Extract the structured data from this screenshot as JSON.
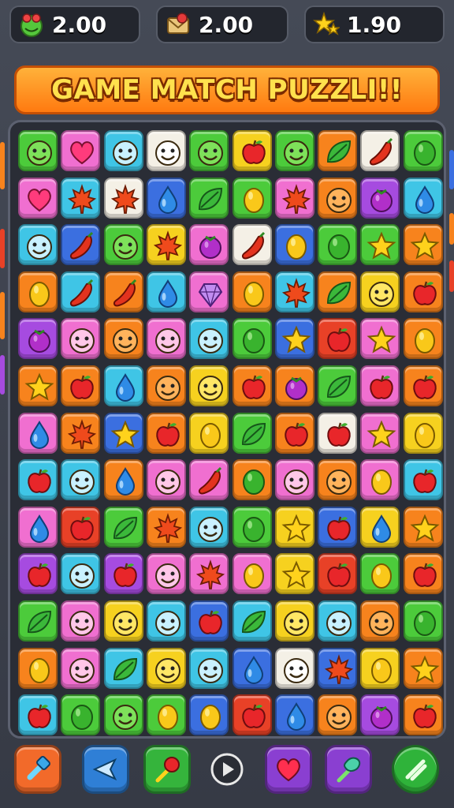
{
  "resources": [
    {
      "icon": "frog-face-icon",
      "value": "2.00"
    },
    {
      "icon": "envelope-icon",
      "value": "2.00"
    },
    {
      "icon": "star-cluster-icon",
      "value": "1.90"
    }
  ],
  "banner": {
    "title": "GAME MATCH PUZZLI!!"
  },
  "board": {
    "rows": 13,
    "cols": 10,
    "tiles": [
      [
        "green:face",
        "pink:heart",
        "cyan:face",
        "white:face",
        "green:face",
        "yellow:apple",
        "green:face",
        "orange:leaf",
        "white:pepper",
        "green:lime"
      ],
      [
        "pink:heart",
        "cyan:maple",
        "white:maple",
        "blue:drop",
        "green:leaf",
        "green:lemon",
        "pink:maple",
        "orange:face",
        "purple:berry",
        "cyan:drop"
      ],
      [
        "cyan:face",
        "blue:pepper",
        "green:face",
        "yellow:maple",
        "pink:berry",
        "white:pepper",
        "blue:lemon",
        "green:lime",
        "green:star",
        "orange:star"
      ],
      [
        "orange:lemon",
        "cyan:pepper",
        "orange:pepper",
        "cyan:drop",
        "pink:crystal",
        "orange:lemon",
        "cyan:maple",
        "orange:leaf",
        "yellow:face",
        "orange:apple"
      ],
      [
        "purple:berry",
        "pink:face",
        "orange:face",
        "pink:face",
        "cyan:face",
        "green:lime",
        "blue:star",
        "red:apple",
        "pink:star",
        "orange:lemon"
      ],
      [
        "orange:star",
        "orange:apple",
        "cyan:drop",
        "orange:face",
        "yellow:face",
        "orange:apple",
        "orange:berry",
        "green:leaf",
        "pink:apple",
        "orange:apple"
      ],
      [
        "pink:drop",
        "orange:maple",
        "blue:star",
        "orange:apple",
        "yellow:lemon",
        "green:leaf",
        "orange:apple",
        "white:apple",
        "pink:star",
        "yellow:lemon"
      ],
      [
        "cyan:apple",
        "cyan:face",
        "orange:drop",
        "pink:face",
        "pink:pepper",
        "orange:lime",
        "pink:face",
        "orange:face",
        "pink:lemon",
        "cyan:apple"
      ],
      [
        "pink:drop",
        "red:apple",
        "green:leaf",
        "orange:maple",
        "cyan:face",
        "green:lime",
        "yellow:star",
        "blue:apple",
        "yellow:drop",
        "orange:star"
      ],
      [
        "purple:apple",
        "cyan:face",
        "purple:apple",
        "pink:face",
        "pink:maple",
        "pink:lemon",
        "yellow:star",
        "red:apple",
        "green:lemon",
        "orange:apple"
      ],
      [
        "green:leaf",
        "pink:face",
        "yellow:face",
        "cyan:face",
        "blue:apple",
        "cyan:leaf",
        "yellow:face",
        "cyan:face",
        "orange:face",
        "green:lime"
      ],
      [
        "orange:lemon",
        "pink:face",
        "cyan:leaf",
        "yellow:face",
        "cyan:face",
        "blue:drop",
        "white:face",
        "blue:maple",
        "yellow:lemon",
        "orange:star"
      ],
      [
        "cyan:apple",
        "green:lime",
        "green:face",
        "green:lemon",
        "blue:lemon",
        "red:apple",
        "blue:drop",
        "orange:face",
        "purple:berry",
        "orange:apple"
      ]
    ]
  },
  "toolbar": [
    {
      "name": "hammer-tool-button",
      "color": "#f26a2a",
      "icon": "hammer-icon"
    },
    {
      "name": "back-arrow-button",
      "color": "#2f7fd6",
      "icon": "arrow-left-icon"
    },
    {
      "name": "pin-tool-button",
      "color": "#35b43c",
      "icon": "pin-icon"
    },
    {
      "name": "play-button",
      "color": "#444955",
      "icon": "play-icon"
    },
    {
      "name": "heart-button",
      "color": "#8a3fd1",
      "icon": "heart-icon"
    },
    {
      "name": "wand-tool-button",
      "color": "#8a3fd1",
      "icon": "wand-icon"
    },
    {
      "name": "confirm-button",
      "color": "#2fb33a",
      "icon": "slash-icon"
    }
  ],
  "colors": {
    "green": "#4ccb3b",
    "pink": "#f06fd0",
    "cyan": "#3fc5e6",
    "white": "#f4f0e6",
    "yellow": "#f6d11f",
    "orange": "#f7831d",
    "purple": "#a64be0",
    "blue": "#3b6fe0",
    "red": "#e84127"
  }
}
